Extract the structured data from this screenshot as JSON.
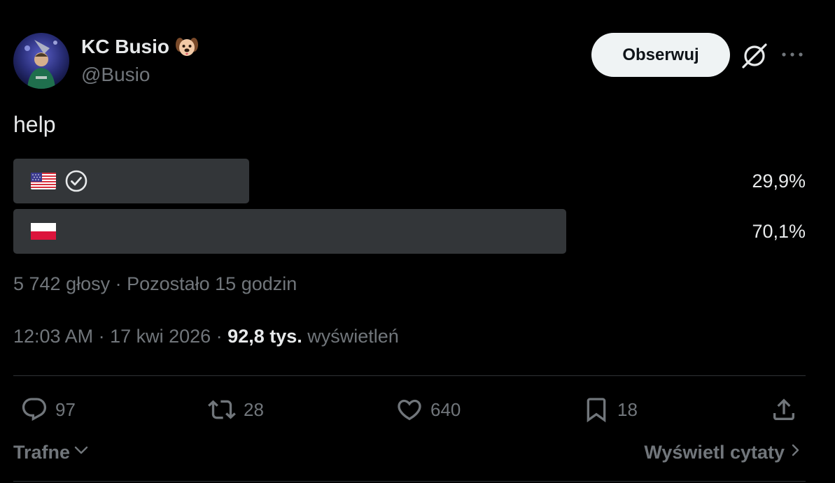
{
  "user": {
    "display_name": "KC Busio",
    "name_emoji": "🐶",
    "handle": "@Busio"
  },
  "header": {
    "follow_label": "Obserwuj",
    "grok_icon": "grok-icon",
    "more_icon": "more-icon"
  },
  "tweet": {
    "text": "help"
  },
  "poll": {
    "options": [
      {
        "flag": "flag-us",
        "check_icon": "check-circle-icon",
        "percent_label": "29,9%",
        "fraction": 0.299
      },
      {
        "flag": "flag-pl",
        "percent_label": "70,1%",
        "fraction": 0.701
      }
    ],
    "meta": "5 742 głosy · Pozostało 15 godzin"
  },
  "meta": {
    "time_date": "12:03 AM · 17 kwi 2026 · ",
    "views_count": "92,8 tys.",
    "views_label": "wyświetleń"
  },
  "actions": {
    "replies": "97",
    "reposts": "28",
    "likes": "640",
    "bookmarks": "18"
  },
  "footer": {
    "sort_label": "Trafne",
    "quotes_label": "Wyświetl cytaty"
  },
  "colors": {
    "background": "#000000",
    "primary_text": "#e7e9ea",
    "secondary_text": "#71767b",
    "poll_bar": "#333639",
    "divider": "#2f3336",
    "follow_button": "#eff3f4"
  }
}
